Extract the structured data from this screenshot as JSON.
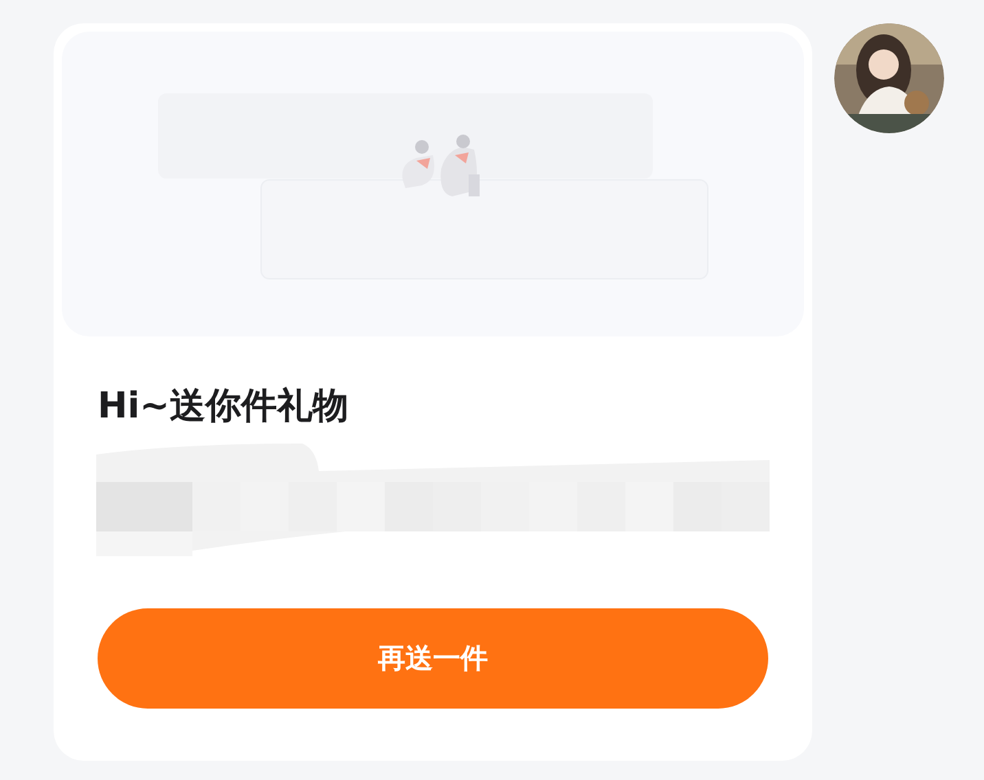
{
  "gift_card": {
    "title": "Hi~送你件礼物",
    "button": "再送一件"
  }
}
